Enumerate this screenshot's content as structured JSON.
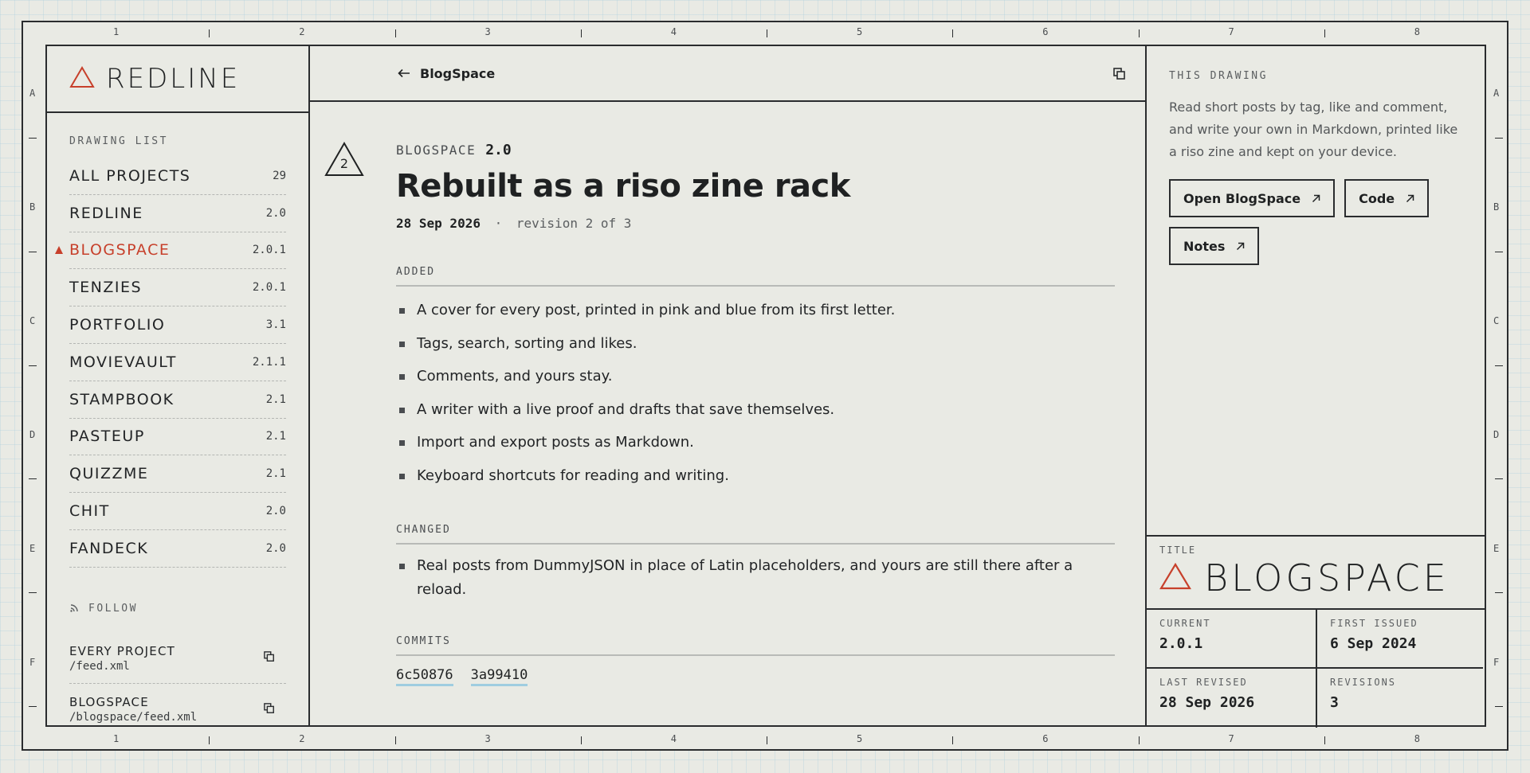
{
  "rulers": {
    "columns": [
      "1",
      "2",
      "3",
      "4",
      "5",
      "6",
      "7",
      "8"
    ],
    "rows": [
      "A",
      "B",
      "C",
      "D",
      "E",
      "F"
    ]
  },
  "sidebar": {
    "brand": "REDLINE",
    "drawing_list_label": "DRAWING LIST",
    "projects": [
      {
        "name": "ALL PROJECTS",
        "version": "29",
        "active": false
      },
      {
        "name": "REDLINE",
        "version": "2.0",
        "active": false
      },
      {
        "name": "BLOGSPACE",
        "version": "2.0.1",
        "active": true
      },
      {
        "name": "TENZIES",
        "version": "2.0.1",
        "active": false
      },
      {
        "name": "PORTFOLIO",
        "version": "3.1",
        "active": false
      },
      {
        "name": "MOVIEVAULT",
        "version": "2.1.1",
        "active": false
      },
      {
        "name": "STAMPBOOK",
        "version": "2.1",
        "active": false
      },
      {
        "name": "PASTEUP",
        "version": "2.1",
        "active": false
      },
      {
        "name": "QUIZZME",
        "version": "2.1",
        "active": false
      },
      {
        "name": "CHIT",
        "version": "2.0",
        "active": false
      },
      {
        "name": "FANDECK",
        "version": "2.0",
        "active": false
      }
    ],
    "follow_label": "FOLLOW",
    "feeds": [
      {
        "name": "EVERY PROJECT",
        "path": "/feed.xml"
      },
      {
        "name": "BLOGSPACE",
        "path": "/blogspace/feed.xml"
      }
    ]
  },
  "main": {
    "back_label": "BlogSpace",
    "revision_badge": "2",
    "app_name": "BLOGSPACE",
    "version": "2.0",
    "headline": "Rebuilt as a riso zine rack",
    "date": "28 Sep 2026",
    "separator": "·",
    "revision_text": "revision 2 of 3",
    "added_label": "ADDED",
    "added": [
      "A cover for every post, printed in pink and blue from its first letter.",
      "Tags, search, sorting and likes.",
      "Comments, and yours stay.",
      "A writer with a live proof and drafts that save themselves.",
      "Import and export posts as Markdown.",
      "Keyboard shortcuts for reading and writing."
    ],
    "changed_label": "CHANGED",
    "changed": [
      "Real posts from DummyJSON in place of Latin placeholders, and yours are still there after a reload."
    ],
    "commits_label": "COMMITS",
    "commits": [
      "6c50876",
      "3a99410"
    ]
  },
  "panel": {
    "label": "THIS DRAWING",
    "description": "Read short posts by tag, like and comment, and write your own in Markdown, printed like a riso zine and kept on your device.",
    "buttons": [
      "Open BlogSpace",
      "Code",
      "Notes"
    ]
  },
  "title_block": {
    "title_label": "TITLE",
    "title": "BLOGSPACE",
    "current_label": "CURRENT",
    "current": "2.0.1",
    "first_issued_label": "FIRST ISSUED",
    "first_issued": "6 Sep 2024",
    "last_revised_label": "LAST REVISED",
    "last_revised": "28 Sep 2026",
    "revisions_label": "REVISIONS",
    "revisions": "3"
  },
  "colors": {
    "accent": "#c7402b",
    "ink": "#1f2122",
    "paper": "#e9eae4",
    "commit_underline": "#9fcde0"
  },
  "icons": [
    "redline-triangle-icon",
    "arrow-left-icon",
    "copy-icon",
    "rss-icon",
    "arrow-up-right-icon",
    "revision-triangle-icon"
  ]
}
